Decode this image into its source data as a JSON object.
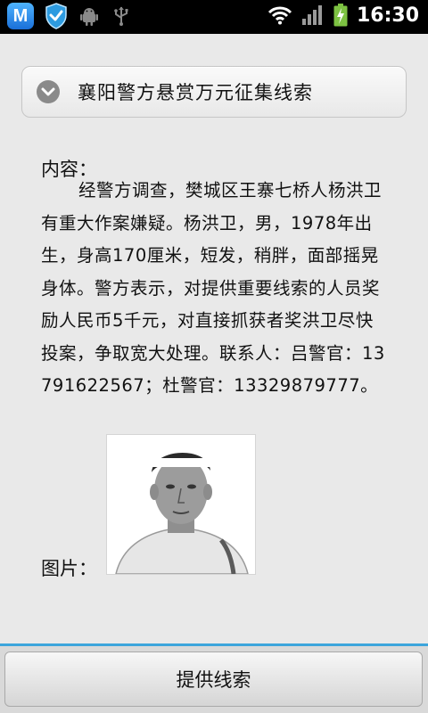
{
  "status_bar": {
    "app_icon_letter": "M",
    "time": "16:30"
  },
  "header": {
    "title": "襄阳警方悬赏万元征集线索"
  },
  "content": {
    "label": "内容：",
    "body": "经警方调查，樊城区王寨七桥人杨洪卫有重大作案嫌疑。杨洪卫，男，1978年出生，身高170厘米，短发，稍胖，面部摇晃身体。警方表示，对提供重要线索的人员奖励人民币5千元，对直接抓获者奖洪卫尽快投案，争取宽大处理。联系人：吕警官：13791622567；杜警官：13329879777。"
  },
  "picture": {
    "label": "图片："
  },
  "action": {
    "label": "提供线索"
  },
  "colors": {
    "accent_line": "#3ca5dc",
    "status_bar": "#000000",
    "battery": "#7dc242"
  }
}
